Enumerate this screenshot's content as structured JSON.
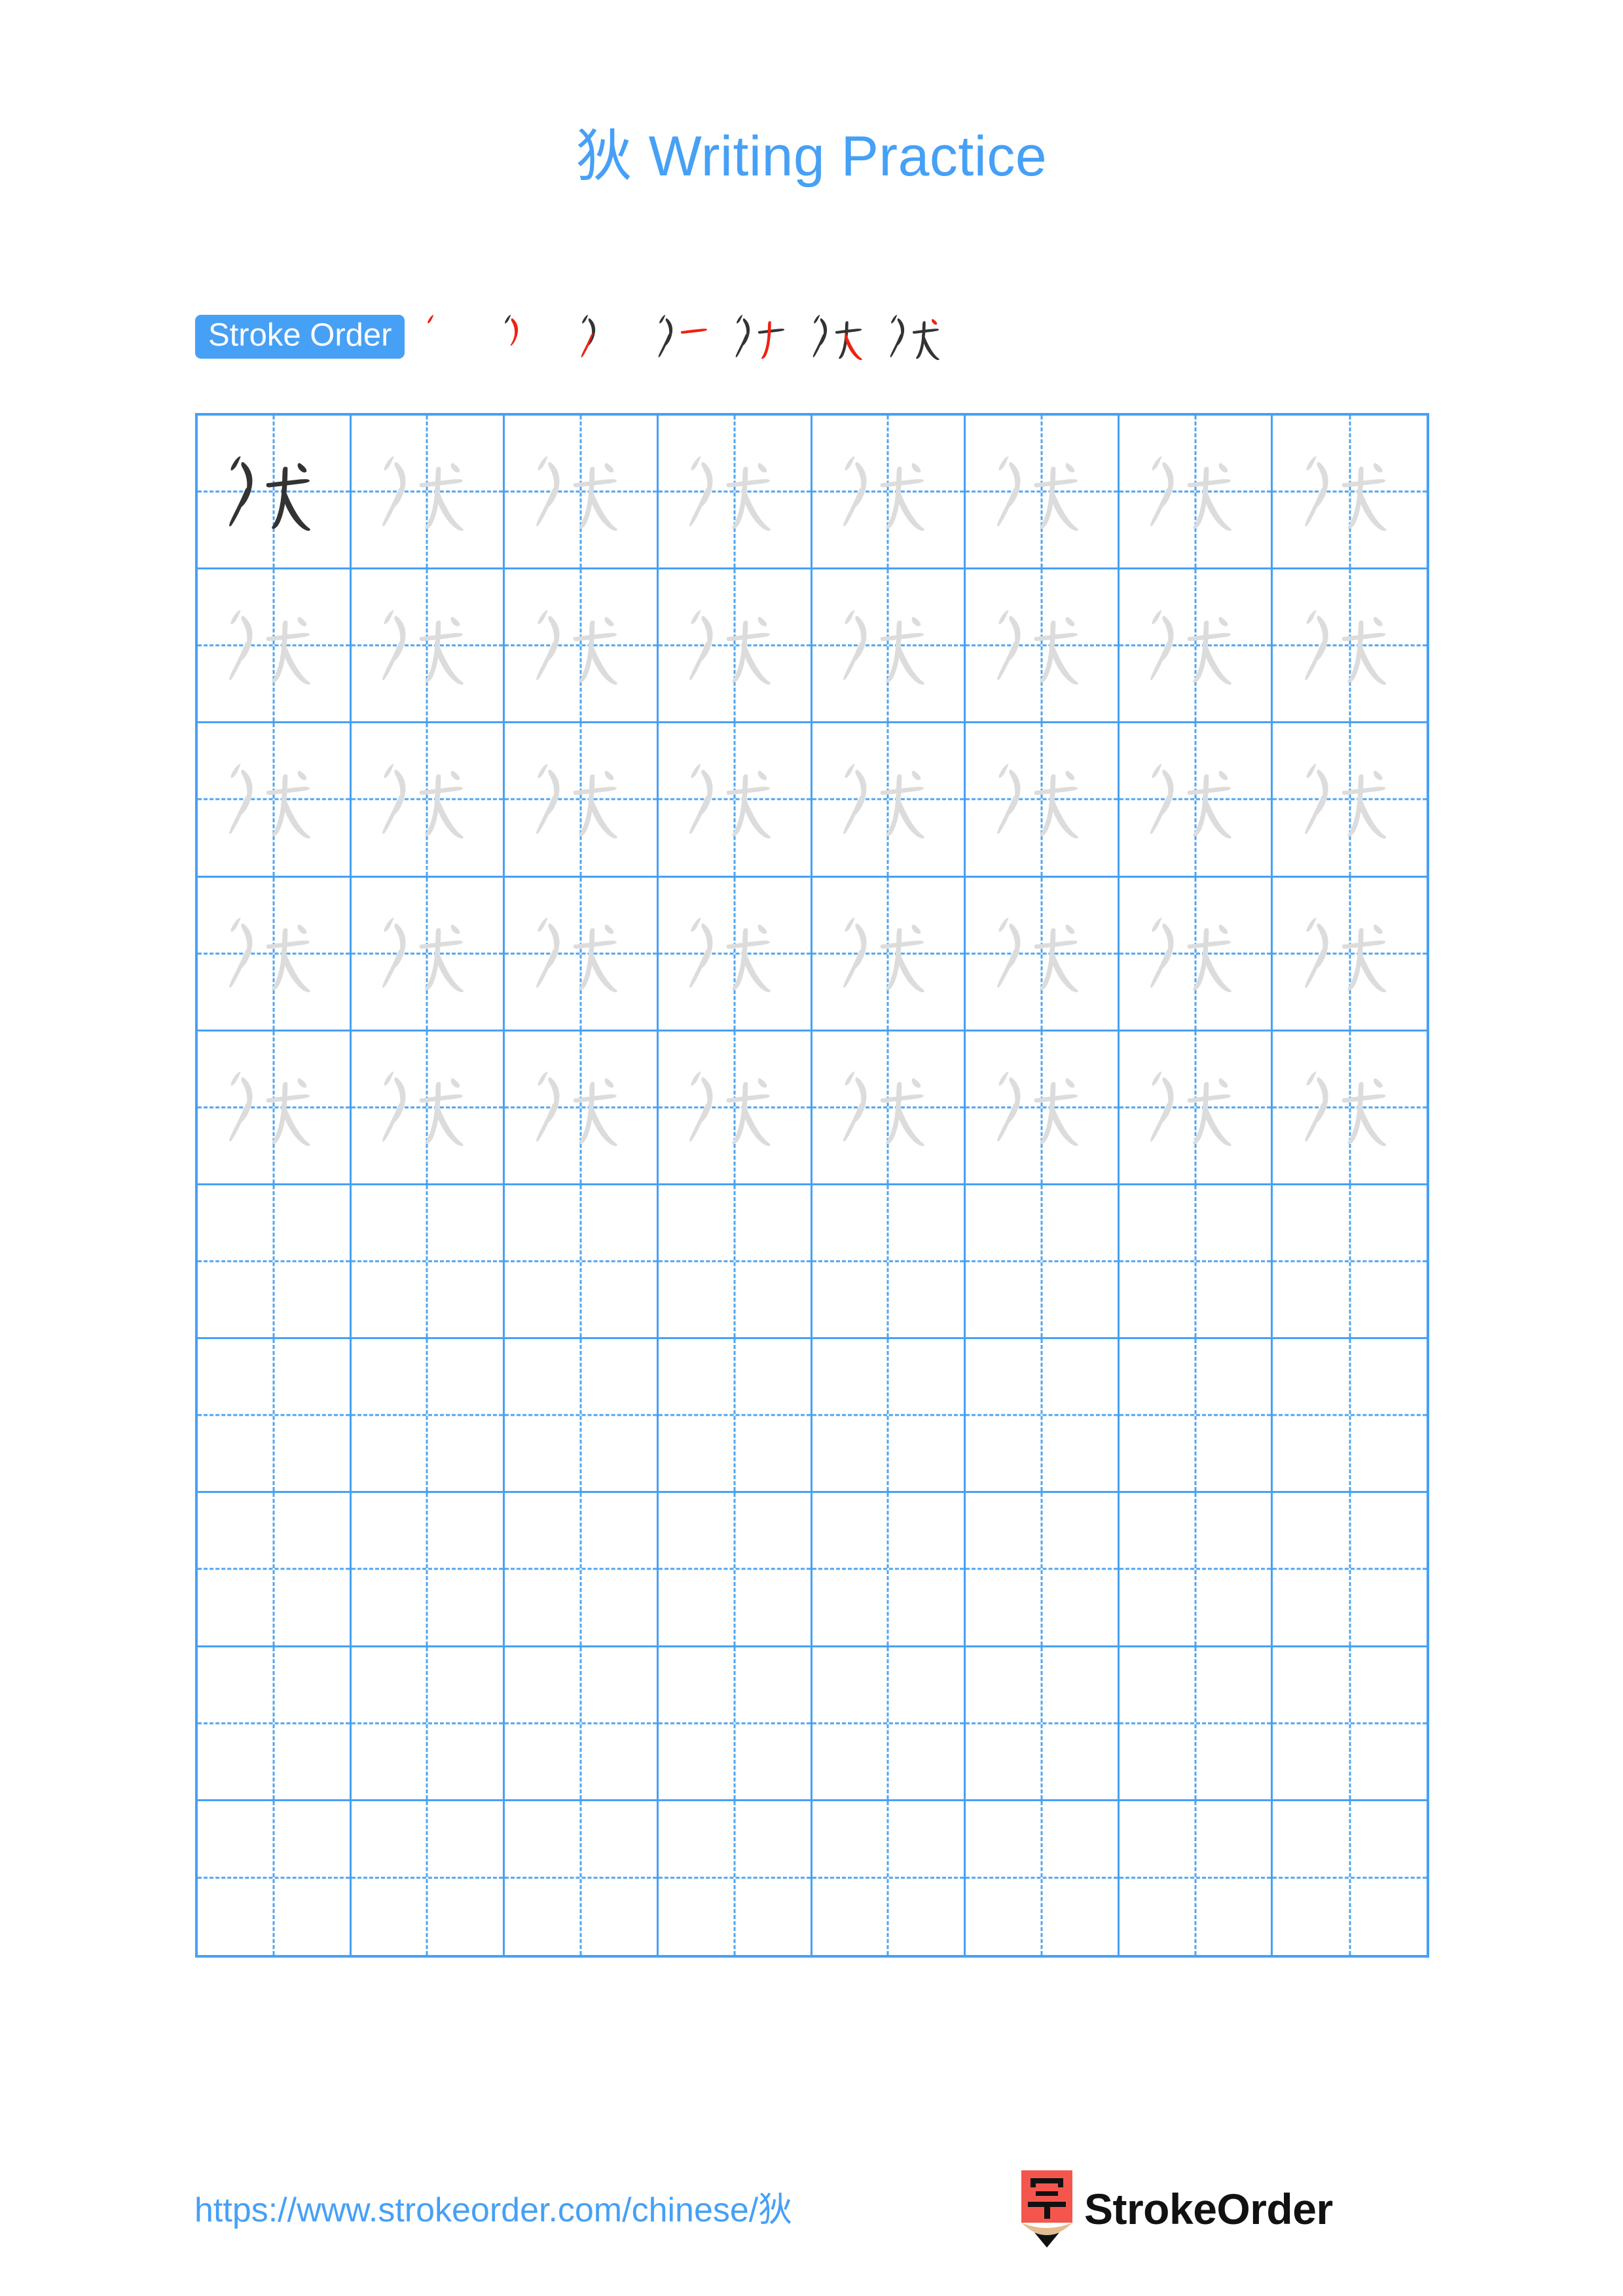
{
  "page": {
    "character": "狄",
    "title": "狄 Writing Practice",
    "background_color": "#ffffff",
    "accent_color": "#46A0F5",
    "trace_color": "#DCDCDC",
    "example_color": "#333333",
    "highlight_stroke_color": "#EE2211"
  },
  "stroke_order": {
    "badge_label": "Stroke Order",
    "stroke_count": 7,
    "steps": [
      {
        "index": 1,
        "strokes_shown": 1,
        "new_stroke": 1,
        "name": "pie"
      },
      {
        "index": 2,
        "strokes_shown": 2,
        "new_stroke": 2,
        "name": "wan-gou"
      },
      {
        "index": 3,
        "strokes_shown": 3,
        "new_stroke": 3,
        "name": "pie"
      },
      {
        "index": 4,
        "strokes_shown": 4,
        "new_stroke": 4,
        "name": "heng"
      },
      {
        "index": 5,
        "strokes_shown": 5,
        "new_stroke": 5,
        "name": "pie"
      },
      {
        "index": 6,
        "strokes_shown": 6,
        "new_stroke": 6,
        "name": "na"
      },
      {
        "index": 7,
        "strokes_shown": 7,
        "new_stroke": 7,
        "name": "dian"
      }
    ]
  },
  "grid": {
    "columns": 8,
    "rows": 10,
    "filled_rows": 5,
    "example_cell": {
      "row": 1,
      "column": 1
    },
    "cells": [
      [
        "example",
        "trace",
        "trace",
        "trace",
        "trace",
        "trace",
        "trace",
        "trace"
      ],
      [
        "trace",
        "trace",
        "trace",
        "trace",
        "trace",
        "trace",
        "trace",
        "trace"
      ],
      [
        "trace",
        "trace",
        "trace",
        "trace",
        "trace",
        "trace",
        "trace",
        "trace"
      ],
      [
        "trace",
        "trace",
        "trace",
        "trace",
        "trace",
        "trace",
        "trace",
        "trace"
      ],
      [
        "trace",
        "trace",
        "trace",
        "trace",
        "trace",
        "trace",
        "trace",
        "trace"
      ],
      [
        "empty",
        "empty",
        "empty",
        "empty",
        "empty",
        "empty",
        "empty",
        "empty"
      ],
      [
        "empty",
        "empty",
        "empty",
        "empty",
        "empty",
        "empty",
        "empty",
        "empty"
      ],
      [
        "empty",
        "empty",
        "empty",
        "empty",
        "empty",
        "empty",
        "empty",
        "empty"
      ],
      [
        "empty",
        "empty",
        "empty",
        "empty",
        "empty",
        "empty",
        "empty",
        "empty"
      ],
      [
        "empty",
        "empty",
        "empty",
        "empty",
        "empty",
        "empty",
        "empty",
        "empty"
      ]
    ]
  },
  "footer": {
    "url": "https://www.strokeorder.com/chinese/狄",
    "brand_name": "StrokeOrder",
    "brand_logo_char": "字",
    "logo_body_color": "#F4564D",
    "logo_wood_color": "#E3BC8F",
    "logo_tip_color": "#111111"
  }
}
